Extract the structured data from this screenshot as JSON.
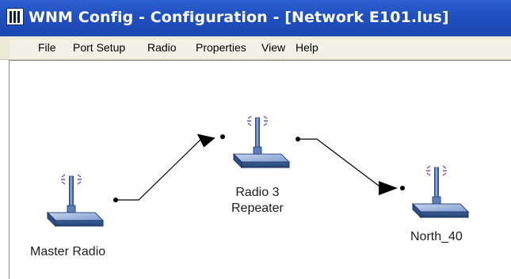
{
  "window": {
    "title": "WNM Config - Configuration - [Network E101.lus]",
    "app_icon": "app-icon"
  },
  "menu": {
    "items": [
      "File",
      "Port Setup",
      "Radio",
      "Properties",
      "View",
      "Help"
    ]
  },
  "nodes": [
    {
      "name": "master-radio",
      "label_lines": [
        "Master Radio"
      ],
      "icon": "radio-device-icon"
    },
    {
      "name": "radio-3-repeater",
      "label_lines": [
        "Radio 3",
        "Repeater"
      ],
      "icon": "radio-device-icon"
    },
    {
      "name": "north-40",
      "label_lines": [
        "North_40"
      ],
      "icon": "radio-device-icon"
    }
  ],
  "links": [
    {
      "from": "Master Radio",
      "to": "Radio 3 Repeater"
    },
    {
      "from": "Radio 3 Repeater",
      "to": "North_40"
    }
  ],
  "colors": {
    "title_bar": "#1f4fbf",
    "menu_bar": "#ece9d8",
    "device_body": "#5b7fb8",
    "antenna_waves": "#7a4fbf",
    "link": "#000000"
  }
}
